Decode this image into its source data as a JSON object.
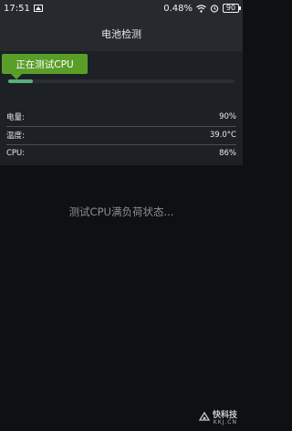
{
  "status_bar": {
    "time": "17:51",
    "data_speed": "0.48",
    "data_unit": "%",
    "battery": "90"
  },
  "header": {
    "title": "电池检测"
  },
  "test": {
    "badge_label": "正在测试CPU",
    "progress_fraction": 0.11
  },
  "stats": [
    {
      "label": "电量:",
      "value": "90%"
    },
    {
      "label": "温度:",
      "value": "39.0°C"
    },
    {
      "label": "CPU:",
      "value": "86%"
    }
  ],
  "message": "测试CPU满负荷状态...",
  "watermark": {
    "main": "快科技",
    "sub": "KKJ.CN"
  }
}
